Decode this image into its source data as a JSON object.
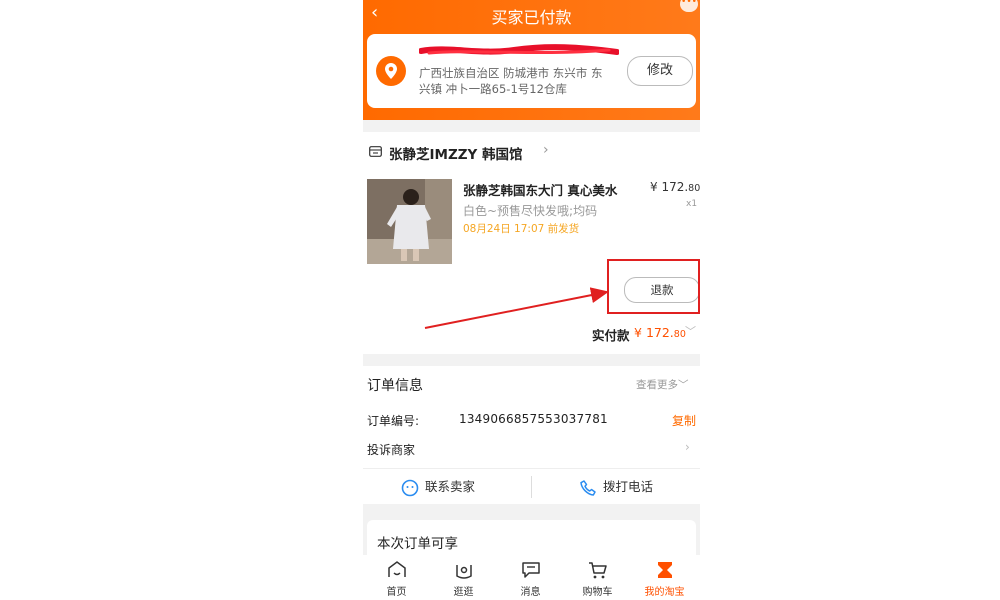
{
  "header": {
    "title": "买家已付款",
    "back_icon": "‹",
    "more_icon": "•••"
  },
  "address": {
    "line1": "广西壮族自治区 防城港市 东兴市 东",
    "line2": "兴镇 冲卜一路65-1号12仓库",
    "edit_label": "修改"
  },
  "store": {
    "name": "张静芝IMZZY 韩国馆",
    "chevron": "›"
  },
  "product": {
    "name": "张静芝韩国东大门 真心美水",
    "sku": "白色~预售尽快发哦;均码",
    "ship": "08月24日 17:07 前发货",
    "price_main": "¥ 172.",
    "price_cents": "80",
    "qty": "x1"
  },
  "refund_label": "退款",
  "paid": {
    "label": "实付款",
    "currency": "¥ ",
    "amount": "172.",
    "cents": "80",
    "chevron": "﹀"
  },
  "order_info": {
    "heading": "订单信息",
    "view_more": "查看更多﹀",
    "order_no_label": "订单编号:",
    "order_no": "1349066857553037781",
    "copy_label": "复制",
    "complain_label": "投诉商家",
    "contact_label": "联系卖家",
    "call_label": "拨打电话"
  },
  "benefit": {
    "title": "本次订单可享"
  },
  "tabs": [
    {
      "label": "首页"
    },
    {
      "label": "逛逛"
    },
    {
      "label": "消息"
    },
    {
      "label": "购物车"
    },
    {
      "label": "我的淘宝"
    }
  ],
  "colors": {
    "brand": "#ff6a00",
    "price": "#ff5000",
    "ship": "#f5a623",
    "annotation": "#e02020"
  }
}
